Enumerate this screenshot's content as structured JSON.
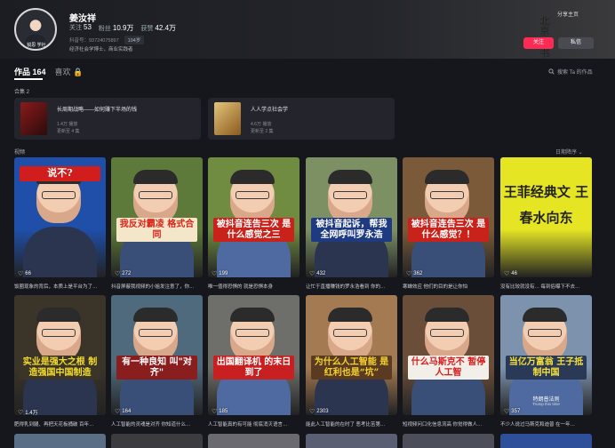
{
  "profile": {
    "name": "姜汝祥",
    "follow_label": "关注",
    "follow_count": "53",
    "fans_label": "粉丝",
    "fans_count": "10.9万",
    "likes_label": "获赞",
    "likes_count": "42.4万",
    "account": "抖音号：93724075897",
    "age_tag": "104岁",
    "bio": "经济社会学博士，商业实践者",
    "avatar_text": "锐思 学社",
    "share_home": "分享主页",
    "follow_button": "关注",
    "message_button": "私信",
    "calligraphy": "北京 尚书"
  },
  "tabs": [
    {
      "label": "作品 164",
      "active": true
    },
    {
      "label": "喜欢 🔒",
      "active": false
    }
  ],
  "search_works": "搜索 Ta 的作品",
  "collections_label": "合集 2",
  "collections": [
    {
      "title": "长周期战略——如何赚下半场的钱",
      "plays": "1.4万 播放",
      "updated": "更新至 4 集",
      "color": "#8b1a1a"
    },
    {
      "title": "人人学点社会学",
      "plays": "4.6万 播放",
      "updated": "更新至 2 集",
      "color": "#c9a24b"
    }
  ],
  "videos_label": "视频",
  "sort_label": "日期降序 ⌄",
  "videos": [
    {
      "likes": "66",
      "caption": "饭圈现象的背后，本质上是平台为了…",
      "overlay": "说不?",
      "bg": "#1f4fa8",
      "text_color": "#ffffff",
      "overlay_bg": "#d21d1d"
    },
    {
      "likes": "272",
      "caption": "抖音屏蔽我视频的小姐发注意了，你…",
      "overlay": "我反对霸凌 格式合同",
      "bg": "#5d7a3a",
      "text_color": "#d8261c",
      "overlay_bg": "#f3e6c9"
    },
    {
      "likes": "199",
      "caption": "唯一值得恐惧的 就是恐惧本身",
      "overlay": "被抖音连告三次 是什么感觉之三",
      "bg": "#6f8c40",
      "text_color": "#ffffff",
      "overlay_bg": "#c8221b"
    },
    {
      "likes": "432",
      "caption": "让忙于直播赚钱的罗永浩看到 你的…",
      "overlay": "被抖音起诉，帮我 全网呼叫罗永浩",
      "bg": "#7c9064",
      "text_color": "#ffffff",
      "overlay_bg": "#1e3a80"
    },
    {
      "likes": "362",
      "caption": "寒蝉效应 他们的目的是让你怕",
      "overlay": "被抖音连告三次 是什么感觉？！",
      "bg": "#7a5a38",
      "text_color": "#ffffff",
      "overlay_bg": "#c8221b"
    },
    {
      "likes": "46",
      "caption": "没有比较就没有… 每到俗曝下不去…",
      "overlay": "王菲经典文 王春水向东",
      "bg": "#e5e524",
      "text_color": "#222222",
      "overlay_bg": "#e5e524"
    },
    {
      "likes": "1.4万",
      "caption": "肥得乳到腿、再把天花板捅破 百年…",
      "overlay": "实业是强大之根 制造强国中国制造",
      "bg": "#3a3429",
      "text_color": "#f4dc2a",
      "overlay_bg": "#3a3429"
    },
    {
      "likes": "164",
      "caption": "人工智能的灵魂是对齐 你知道什么…",
      "overlay": "有一种良知 叫\"对齐\"",
      "bg": "#4f6a7c",
      "text_color": "#ffffff",
      "overlay_bg": "#8a1d1d"
    },
    {
      "likes": "185",
      "caption": "人工智能真的有可能 彻底消灭语言…",
      "overlay": "出国翻译机 的末日到了",
      "bg": "#6e6e6a",
      "text_color": "#ffffff",
      "overlay_bg": "#c82020"
    },
    {
      "likes": "2303",
      "caption": "能此人工智能的在时了 恶考比苦第…",
      "overlay": "为什么人工智能 是红利也是“坑”",
      "bg": "#a47a52",
      "text_color": "#f5d42c",
      "overlay_bg": "#5a3b22"
    },
    {
      "likes": "",
      "caption": "短视频问口化信息流高 你觉得做人…",
      "overlay": "什么马斯克不 暂停人工智",
      "bg": "#6b4e3a",
      "text_color": "#d71c1c",
      "overlay_bg": "#f1efe8"
    },
    {
      "likes": "357",
      "caption": "不少人说过马斯克和迪普 在一年…",
      "overlay": "当亿万富翁 王子抵制中国",
      "bg": "#7d92ad",
      "text_color": "#f6e03a",
      "overlay_bg": "#2a3a56",
      "subtitle": "特朗普法则",
      "subtitle2": "Trump this time"
    }
  ]
}
